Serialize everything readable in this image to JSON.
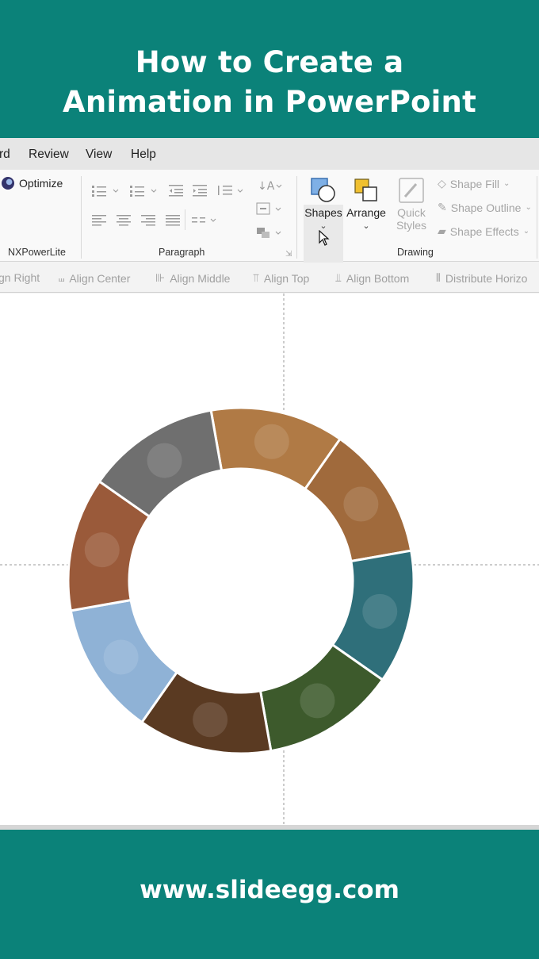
{
  "banner": {
    "title_line1": "How to Create a",
    "title_line2": "Animation in PowerPoint",
    "website": "www.slideegg.com",
    "color": "#0b8279"
  },
  "menu": {
    "items": [
      "rd",
      "Review",
      "View",
      "Help"
    ]
  },
  "ribbon": {
    "nxpowerlite": {
      "button_label": "Optimize",
      "group_label": "NXPowerLite"
    },
    "paragraph": {
      "group_label": "Paragraph"
    },
    "drawing": {
      "group_label": "Drawing",
      "shapes_label": "Shapes",
      "arrange_label": "Arrange",
      "quick_styles_line1": "Quick",
      "quick_styles_line2": "Styles",
      "shape_fill_label": "Shape Fill",
      "shape_outline_label": "Shape Outline",
      "shape_effects_label": "Shape Effects"
    }
  },
  "align_toolbar": {
    "align_right": "gn Right",
    "align_center": "Align Center",
    "align_middle": "Align Middle",
    "align_top": "Align Top",
    "align_bottom": "Align Bottom",
    "distribute": "Distribute Horizo"
  },
  "slide": {
    "ring_segments": [
      {
        "icon": "architecture-photo",
        "color": "#b07a45"
      },
      {
        "icon": "cheetah-photo",
        "color": "#a06a3c"
      },
      {
        "icon": "coral-reef-photo",
        "color": "#2f6f7a"
      },
      {
        "icon": "forest-photo",
        "color": "#3d5a2c"
      },
      {
        "icon": "food-photo",
        "color": "#5a3a22"
      },
      {
        "icon": "sky-clouds-photo",
        "color": "#8fb2d6"
      },
      {
        "icon": "canyon-photo",
        "color": "#9a5a3a"
      },
      {
        "icon": "mountain-road-photo",
        "color": "#6f6f6f"
      }
    ]
  }
}
